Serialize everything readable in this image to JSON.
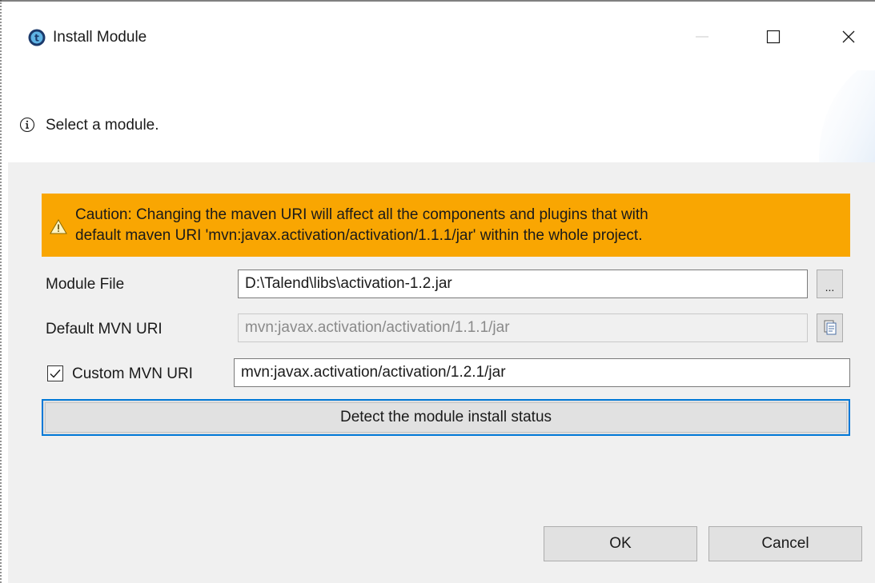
{
  "window": {
    "title": "Install Module",
    "app_icon": "talend-icon",
    "controls": {
      "minimize": "minimize-icon",
      "maximize": "maximize-icon",
      "close": "close-icon"
    }
  },
  "header": {
    "message": "Select a module.",
    "icon": "info-icon"
  },
  "caution": {
    "line1": "Caution: Changing the maven URI will affect all the components and plugins that with",
    "line2": "default maven URI 'mvn:javax.activation/activation/1.1.1/jar' within the whole project.",
    "icon": "warning-icon",
    "color": "#f9a602"
  },
  "form": {
    "module_file_label": "Module File",
    "module_file_value": "D:\\Talend\\libs\\activation-1.2.jar",
    "browse_label": "...",
    "default_uri_label": "Default MVN URI",
    "default_uri_value": "mvn:javax.activation/activation/1.1.1/jar",
    "copy_icon": "copy-icon",
    "custom_uri_label": "Custom MVN URI",
    "custom_uri_checked": true,
    "custom_uri_value": "mvn:javax.activation/activation/1.2.1/jar",
    "detect_label": "Detect the module install status"
  },
  "buttons": {
    "ok": "OK",
    "cancel": "Cancel"
  },
  "colors": {
    "body_bg": "#f0f0f0",
    "focus_border": "#0078d7",
    "button_bg": "#e1e1e1"
  }
}
